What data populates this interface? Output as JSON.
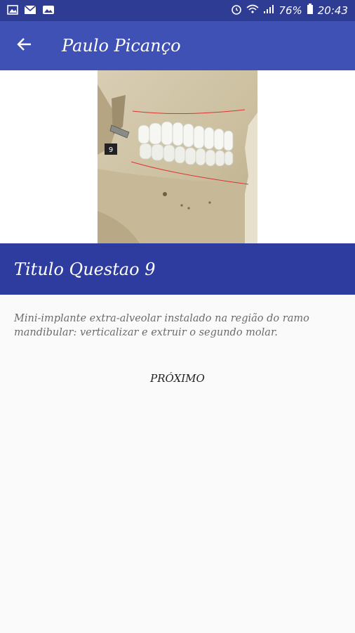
{
  "status_bar": {
    "battery_percent": "76%",
    "time": "20:43",
    "left_icons": [
      "image-icon",
      "mail-icon",
      "gallery-icon"
    ],
    "right_icons": [
      "alarm-icon",
      "wifi-icon",
      "signal-icon",
      "battery-icon"
    ]
  },
  "app_bar": {
    "title": "Paulo Picanço",
    "back_icon": "arrow-left-icon"
  },
  "image": {
    "marker_label": "9"
  },
  "question": {
    "title": "Titulo Questao 9",
    "description": "Mini-implante extra-alveolar instalado na região do ramo mandibular: verticalizar e extruir o segundo molar."
  },
  "actions": {
    "next_label": "PRÓXIMO"
  },
  "colors": {
    "status_bar": "#2e3c93",
    "app_bar": "#3f51b5",
    "title_band": "#2e3c9f",
    "background": "#fafafa"
  }
}
